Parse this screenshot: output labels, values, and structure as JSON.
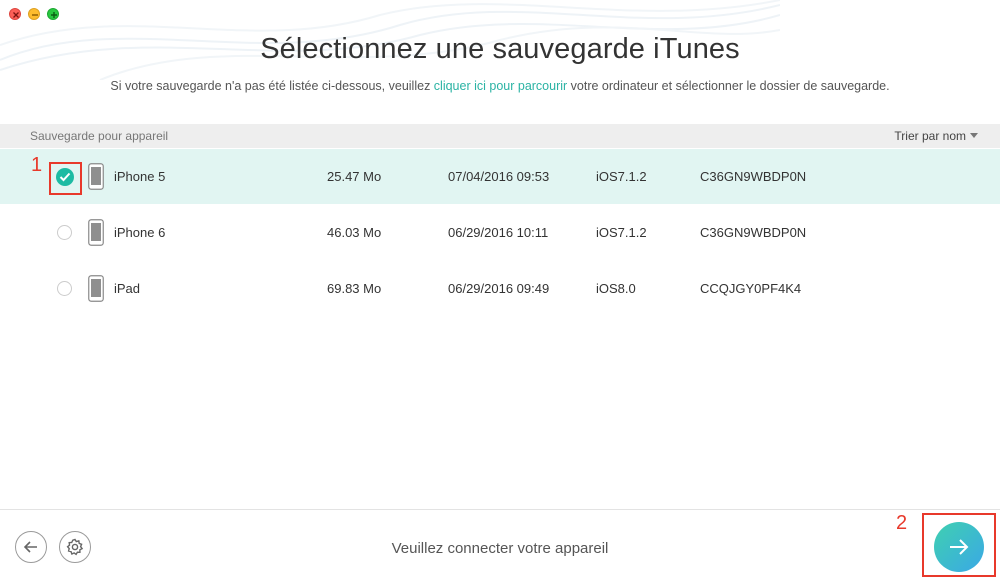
{
  "window": {
    "title": "Sélectionnez une sauvegarde iTunes"
  },
  "subtitle": {
    "before": "Si votre sauvegarde n'a pas été listée ci-dessous, veuillez ",
    "link": "cliquer ici pour parcourir",
    "after": " votre ordinateur et sélectionner le dossier de sauvegarde."
  },
  "list_header": {
    "column_label": "Sauvegarde pour appareil",
    "sort_label": "Trier par nom"
  },
  "backups": [
    {
      "name": "iPhone 5",
      "size": "25.47 Mo",
      "date": "07/04/2016 09:53",
      "ios": "iOS7.1.2",
      "serial": "C36GN9WBDP0N",
      "selected": true
    },
    {
      "name": "iPhone 6",
      "size": "46.03 Mo",
      "date": "06/29/2016 10:11",
      "ios": "iOS7.1.2",
      "serial": "C36GN9WBDP0N",
      "selected": false
    },
    {
      "name": "iPad",
      "size": "69.83 Mo",
      "date": "06/29/2016 09:49",
      "ios": "iOS8.0",
      "serial": "CCQJGY0PF4K4",
      "selected": false
    }
  ],
  "footer": {
    "status_text": "Veuillez connecter votre appareil"
  },
  "annotations": {
    "step1": "1",
    "step2": "2"
  },
  "icons": {
    "back": "arrow-left-icon",
    "settings": "gear-icon",
    "next": "arrow-right-icon",
    "device": "iphone-icon",
    "check": "checkmark-icon"
  },
  "colors": {
    "accent": "#1dbba3",
    "link": "#2bb3a4",
    "selected_row": "#e1f5f2",
    "annotation": "#e8392b"
  }
}
